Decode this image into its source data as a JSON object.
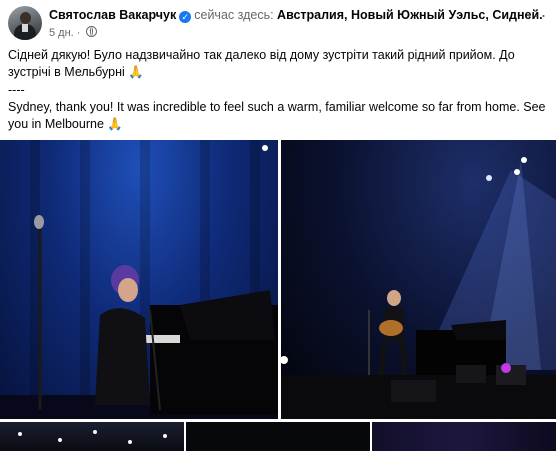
{
  "post": {
    "author": "Святослав Вакарчук",
    "verified_icon": "verified-badge-icon",
    "location_prefix": "сейчас здесь:",
    "location": "Австралия, Новый Южный Уэльс, Сидней.",
    "time": "5 дн.",
    "audience_icon": "globe-icon",
    "menu_icon": "more-options-icon",
    "text_uk": "Сідней дякую! Було надзвичайно так далеко від дому зустріти такий рідний прийом. До зустрічі в Мельбурні 🙏",
    "separator": "----",
    "text_en": "Sydney, thank you! It was incredible to feel such a warm, familiar welcome so far from home. See you in Melbourne 🙏"
  },
  "colors": {
    "accent": "#1877f2",
    "muted_text": "#65676b"
  }
}
